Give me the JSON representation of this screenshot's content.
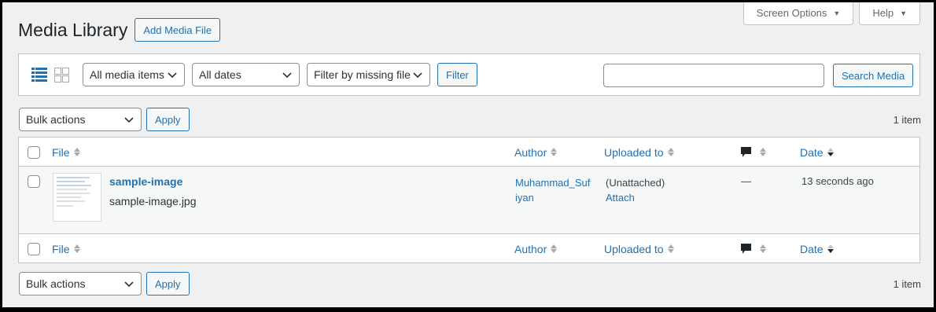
{
  "screen_options": {
    "screen_options_label": "Screen Options",
    "help_label": "Help"
  },
  "header": {
    "title": "Media Library",
    "add_button": "Add Media File"
  },
  "filters": {
    "type_select": "All media items",
    "date_select": "All dates",
    "missing_select": "Filter by missing file",
    "filter_button": "Filter",
    "search_value": "",
    "search_button": "Search Media"
  },
  "tablenav_top": {
    "bulk_select": "Bulk actions",
    "apply": "Apply",
    "count": "1 item"
  },
  "tablenav_bottom": {
    "bulk_select": "Bulk actions",
    "apply": "Apply",
    "count": "1 item"
  },
  "columns": {
    "file": "File",
    "author": "Author",
    "uploaded_to": "Uploaded to",
    "date": "Date"
  },
  "rows": [
    {
      "title": "sample-image",
      "filename": "sample-image.jpg",
      "author": "Muhammad_Sufiyan",
      "uploaded_status": "(Unattached)",
      "attach_link": "Attach",
      "comments": "—",
      "date": "13 seconds ago"
    }
  ],
  "colors": {
    "link": "#2271b1",
    "border": "#c3c4c7",
    "background": "#f0f0f1"
  },
  "icons": [
    "list-view-icon",
    "grid-view-icon",
    "chevron-down-icon",
    "comment-icon",
    "sort-icon"
  ]
}
